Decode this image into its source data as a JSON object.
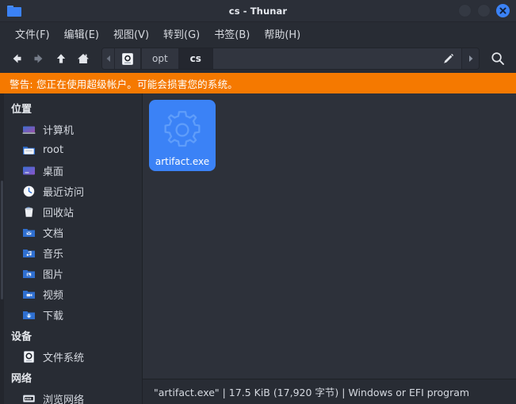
{
  "window": {
    "title": "cs - Thunar",
    "folder_icon": "folder-icon",
    "controls": {
      "minimize": "minimize-button",
      "maximize": "maximize-button",
      "close": "close-button"
    }
  },
  "menubar": {
    "items": [
      {
        "label": "文件(F)",
        "name": "menu-file"
      },
      {
        "label": "编辑(E)",
        "name": "menu-edit"
      },
      {
        "label": "视图(V)",
        "name": "menu-view"
      },
      {
        "label": "转到(G)",
        "name": "menu-go"
      },
      {
        "label": "书签(B)",
        "name": "menu-bookmarks"
      },
      {
        "label": "帮助(H)",
        "name": "menu-help"
      }
    ]
  },
  "toolbar": {
    "back": "back-icon",
    "forward": "forward-icon",
    "up": "up-icon",
    "home": "home-icon",
    "edit_path": "pencil-icon",
    "search": "search-icon",
    "breadcrumbs": [
      {
        "label": "",
        "icon": "device-icon",
        "active": false
      },
      {
        "label": "opt",
        "active": false
      },
      {
        "label": "cs",
        "active": true
      }
    ]
  },
  "warning": {
    "text": "警告: 您正在使用超级帐户。可能会损害您的系统。",
    "color": "#f57900"
  },
  "sidebar": {
    "sections": [
      {
        "title": "位置",
        "name": "sidebar-section-places",
        "items": [
          {
            "label": "计算机",
            "icon": "computer-icon",
            "name": "sidebar-item-computer"
          },
          {
            "label": "root",
            "icon": "home-folder-icon",
            "name": "sidebar-item-root"
          },
          {
            "label": "桌面",
            "icon": "desktop-icon",
            "name": "sidebar-item-desktop"
          },
          {
            "label": "最近访问",
            "icon": "clock-icon",
            "name": "sidebar-item-recent"
          },
          {
            "label": "回收站",
            "icon": "trash-icon",
            "name": "sidebar-item-trash"
          },
          {
            "label": "文档",
            "icon": "documents-folder-icon",
            "name": "sidebar-item-documents"
          },
          {
            "label": "音乐",
            "icon": "music-folder-icon",
            "name": "sidebar-item-music"
          },
          {
            "label": "图片",
            "icon": "pictures-folder-icon",
            "name": "sidebar-item-pictures"
          },
          {
            "label": "视频",
            "icon": "videos-folder-icon",
            "name": "sidebar-item-videos"
          },
          {
            "label": "下载",
            "icon": "downloads-folder-icon",
            "name": "sidebar-item-downloads"
          }
        ]
      },
      {
        "title": "设备",
        "name": "sidebar-section-devices",
        "items": [
          {
            "label": "文件系统",
            "icon": "drive-icon",
            "name": "sidebar-item-filesystem"
          }
        ]
      },
      {
        "title": "网络",
        "name": "sidebar-section-network",
        "items": [
          {
            "label": "浏览网络",
            "icon": "network-icon",
            "name": "sidebar-item-browse-network"
          }
        ]
      }
    ]
  },
  "main": {
    "files": [
      {
        "name": "artifact.exe",
        "icon": "gear-icon",
        "selected": true
      }
    ]
  },
  "statusbar": {
    "text": "\"artifact.exe\" | 17.5 KiB (17,920 字节) | Windows or EFI program"
  },
  "colors": {
    "accent": "#3b82f6",
    "warning": "#f57900",
    "window_bg": "#282c34",
    "main_bg": "#2d313a"
  }
}
